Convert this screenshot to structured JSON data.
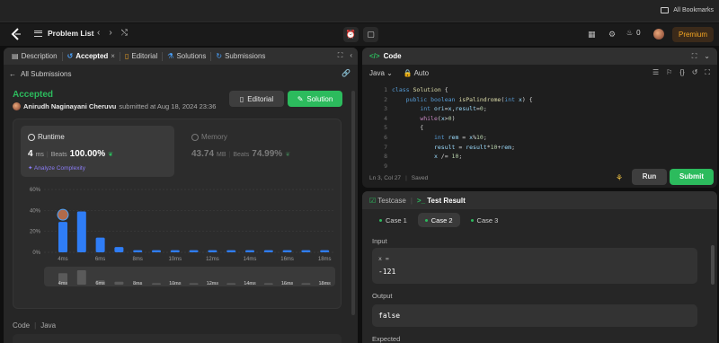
{
  "browser": {
    "bookmarks_label": "All Bookmarks"
  },
  "nav": {
    "problem_list": "Problem List",
    "streak": "0",
    "premium": "Premium"
  },
  "left_tabs": {
    "description": "Description",
    "accepted": "Accepted",
    "editorial": "Editorial",
    "solutions": "Solutions",
    "submissions": "Submissions"
  },
  "back_link": "All Submissions",
  "submission": {
    "status": "Accepted",
    "user": "Anirudh Naginayani Cheruvu",
    "submitted_text": "submitted at Aug 18, 2024 23:36",
    "editorial_button": "Editorial",
    "solution_button": "Solution"
  },
  "runtime": {
    "label": "Runtime",
    "value": "4",
    "unit": "ms",
    "beats_label": "Beats",
    "beats": "100.00%",
    "analyze": "Analyze Complexity"
  },
  "memory": {
    "label": "Memory",
    "value": "43.74",
    "unit": "MB",
    "beats_label": "Beats",
    "beats": "74.99%"
  },
  "chart_data": {
    "type": "bar",
    "ylabel": "",
    "y_ticks": [
      "60%",
      "40%",
      "20%",
      "0%"
    ],
    "ylim": [
      0,
      60
    ],
    "x_tick_labels": [
      "4ms",
      "6ms",
      "8ms",
      "10ms",
      "12ms",
      "14ms",
      "16ms",
      "18ms"
    ],
    "values": [
      29,
      39,
      14,
      5,
      2,
      2,
      2,
      2,
      2,
      2,
      2,
      2,
      2,
      2,
      2
    ],
    "highlight_index": 0,
    "overview_values": [
      8,
      10,
      3,
      2,
      1,
      1,
      1,
      1,
      1,
      1,
      1,
      1,
      1,
      1,
      1
    ],
    "overview_tick_labels": [
      "4ms",
      "6ms",
      "8ms",
      "10ms",
      "12ms",
      "14ms",
      "16ms",
      "18ms"
    ],
    "colors": {
      "bar": "#2f7df6",
      "overview_bar": "#5a5a5a",
      "grid": "#3c3c3c"
    }
  },
  "code_section": {
    "label": "Code",
    "language": "Java"
  },
  "editor": {
    "title": "Code",
    "language": "Java",
    "mode": "Auto",
    "line_numbers": [
      "1",
      "2",
      "3",
      "4",
      "5",
      "6",
      "7",
      "8",
      "9"
    ],
    "status_position": "Ln 3, Col 27",
    "status_saved": "Saved"
  },
  "actions": {
    "run": "Run",
    "submit": "Submit"
  },
  "test": {
    "testcase_tab": "Testcase",
    "result_tab": "Test Result",
    "cases": [
      "Case 1",
      "Case 2",
      "Case 3"
    ],
    "selected_case": 1,
    "input_label": "Input",
    "input_var": "x =",
    "input_value": "-121",
    "output_label": "Output",
    "output_value": "false",
    "expected_label": "Expected"
  }
}
